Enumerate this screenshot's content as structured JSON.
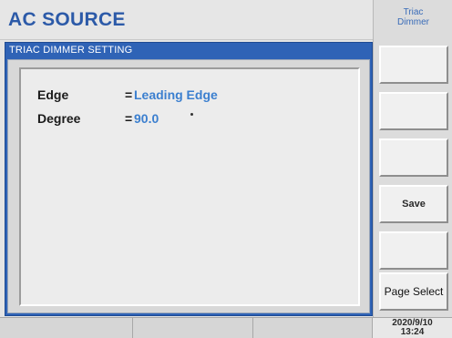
{
  "header": {
    "title": "AC SOURCE"
  },
  "panel": {
    "title": "TRIAC DIMMER SETTING",
    "params": [
      {
        "label": "Edge",
        "eq": "=",
        "value": "Leading Edge"
      },
      {
        "label": "Degree",
        "eq": "=",
        "value": "90.0"
      }
    ]
  },
  "sidebar": {
    "mode_title_line1": "Triac",
    "mode_title_line2": "Dimmer",
    "keys": [
      "",
      "",
      "",
      "Save",
      "",
      "Page Select"
    ]
  },
  "status": {
    "date": "2020/9/10",
    "time": "13:24"
  },
  "colors": {
    "accent": "#2f63b6",
    "title": "#2c5aa8",
    "value": "#3b7fcf"
  }
}
